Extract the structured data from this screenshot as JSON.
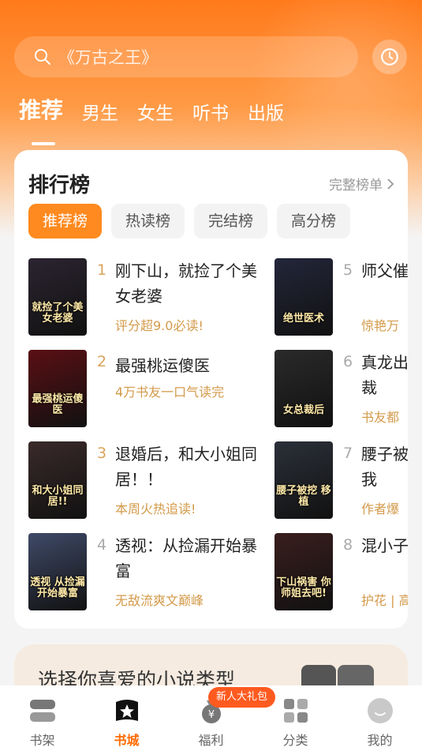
{
  "search": {
    "placeholder": "《万古之王》"
  },
  "tabs": [
    "推荐",
    "男生",
    "女生",
    "听书",
    "出版"
  ],
  "ranking": {
    "title": "排行榜",
    "more": "完整榜单",
    "filters": [
      "推荐榜",
      "热读榜",
      "完结榜",
      "高分榜"
    ],
    "books": [
      {
        "rank": "1",
        "title": "刚下山，就捡了个美女老婆",
        "tag": "评分超9.0必读!",
        "cover_text": "就捡了个美女老婆",
        "cover_color": "#2b2430"
      },
      {
        "rank": "2",
        "title": "最强桃运傻医",
        "tag": "4万书友一口气读完",
        "cover_text": "最强桃运傻医",
        "cover_color": "#5a0f14"
      },
      {
        "rank": "3",
        "title": "退婚后，和大小姐同居！！",
        "tag": "本周火热追读!",
        "cover_text": "和大小姐同居!!",
        "cover_color": "#3a2a2a"
      },
      {
        "rank": "4",
        "title": "透视：从捡漏开始暴富",
        "tag": "无敌流爽文巅峰",
        "cover_text": "透视 从捡漏开始暴富",
        "cover_color": "#3f4a68"
      },
      {
        "rank": "5",
        "title": "师父催我下山",
        "tag": "惊艳万",
        "cover_text": "绝世医术",
        "cover_color": "#23263a"
      },
      {
        "rank": "6",
        "title": "真龙出狱：物人女总裁",
        "tag": "书友都",
        "cover_text": "女总裁后",
        "cover_color": "#2a2a2a"
      },
      {
        "rank": "7",
        "title": "腰子被挖，移植肾后我",
        "tag": "作者爆",
        "cover_text": "腰子被挖 移植",
        "cover_color": "#2b3039"
      },
      {
        "rank": "8",
        "title": "混小子，师娘啊",
        "tag": "护花 | 高",
        "cover_text": "下山祸害 你师姐去吧!",
        "cover_color": "#3a1e1e"
      }
    ]
  },
  "promo": {
    "text": "选择你喜爱的小说类型"
  },
  "nav": {
    "items": [
      "书架",
      "书城",
      "福利",
      "分类",
      "我的"
    ],
    "gift_badge": "新人大礼包"
  },
  "colors": {
    "accent": "#ff8a1f",
    "rank_gold": "#d9a35a",
    "tag": "#d39a4a"
  }
}
